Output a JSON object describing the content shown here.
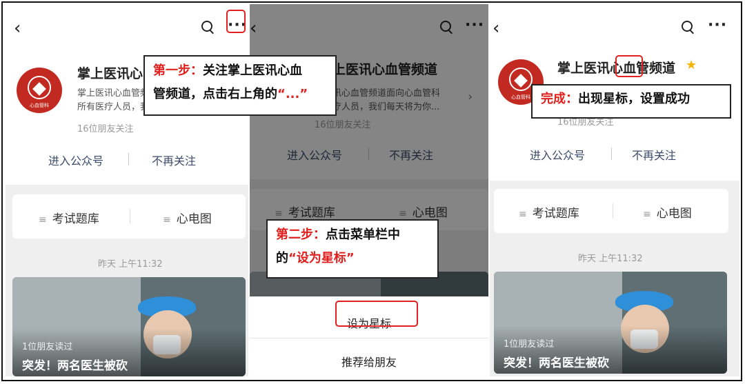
{
  "account": {
    "name": "掌上医讯心血管频道",
    "name_short": "掌上医讯心",
    "name_tail": "上医讯心血管频道",
    "name_head": "掌上医讯心",
    "name_mid": "血",
    "name_end": "管频道",
    "desc_line1": "掌上医讯心血管频道面向心血管科",
    "desc_line2": "所有医疗人员，我们每天将为你...",
    "desc_line1_p2": "讯心血管频道面向心血管科",
    "desc_line2_p2": "疗人员，我们每天将为你...",
    "friends_follow": "16位朋友关注",
    "logo_text": "心血管科"
  },
  "actions": {
    "enter": "进入公众号",
    "unfollow": "不再关注"
  },
  "menu": {
    "item1": "考试题库",
    "item2": "心电图",
    "lines_icon": "≡"
  },
  "feed": {
    "date": "昨天 上午11:32",
    "article_sub": "1位朋友读过",
    "article_title": "突发！两名医生被砍"
  },
  "sheet": {
    "star": "设为星标",
    "recommend": "推荐给朋友"
  },
  "nav": {
    "back_icon": "chevron-left-icon",
    "search_icon": "search-icon",
    "more_icon": "more-icon",
    "back_glyph": "‹",
    "more_glyph": "···"
  },
  "callouts": {
    "step1_label": "第一步：",
    "step1_text_a": "关注掌上医讯心血",
    "step1_text_b": "管频道，点击右上角的",
    "step1_quote": "“...”",
    "step2_label": "第二步：",
    "step2_text_a": "点击菜单栏中",
    "step2_text_b": "的",
    "step2_quote": "“设为星标”",
    "done_label": "完成：",
    "done_text": "出现星标，设置成功"
  },
  "colors": {
    "accent_red": "#e0201e",
    "star": "#f5b400",
    "logo": "#c22a21",
    "link": "#3b4a6b"
  }
}
